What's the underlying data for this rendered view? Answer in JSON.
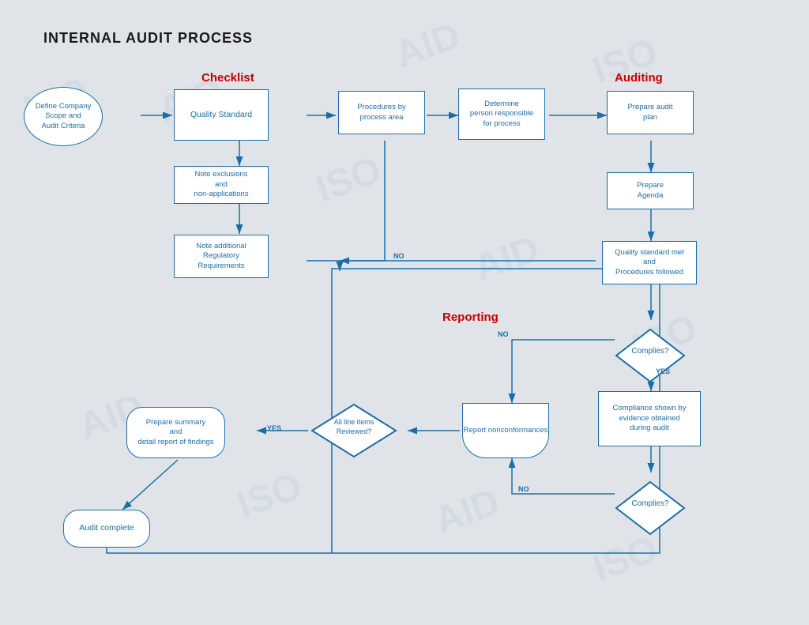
{
  "title": "INTERNAL AUDIT PROCESS",
  "sections": {
    "checklist": "Checklist",
    "auditing": "Auditing",
    "reporting": "Reporting"
  },
  "nodes": {
    "define": "Define Company\nScope and\nAudit Criteria",
    "quality": "Quality Standard",
    "exclusions": "Note exclusions\nand\nnon-applications",
    "regulatory": "Note additional\nRegulatory\nRequirements",
    "procedures": "Procedures by\nprocess area",
    "determine": "Determine\nperson responsible\nfor process",
    "prepare_plan": "Prepare audit\nplan",
    "prepare_agenda": "Prepare\nAgenda",
    "quality_met": "Quality standard met\nand\nProcedures followed",
    "complies1": "Complies?",
    "compliance_shown": "Compliance shown by\nevidence obtained\nduring audit",
    "complies2": "Complies?",
    "report_nonconf": "Report\nnonconformances",
    "all_items": "All line items\nReviewed?",
    "prepare_summary": "Prepare summary\nand\ndetail report of findings",
    "audit_complete": "Audit complete"
  },
  "labels": {
    "no1": "NO",
    "no2": "NO",
    "no3": "NO",
    "yes1": "YES",
    "yes2": "YES"
  },
  "colors": {
    "blue": "#1a6ea8",
    "red": "#cc0000",
    "bg": "#e0e4e8",
    "white": "#ffffff"
  }
}
